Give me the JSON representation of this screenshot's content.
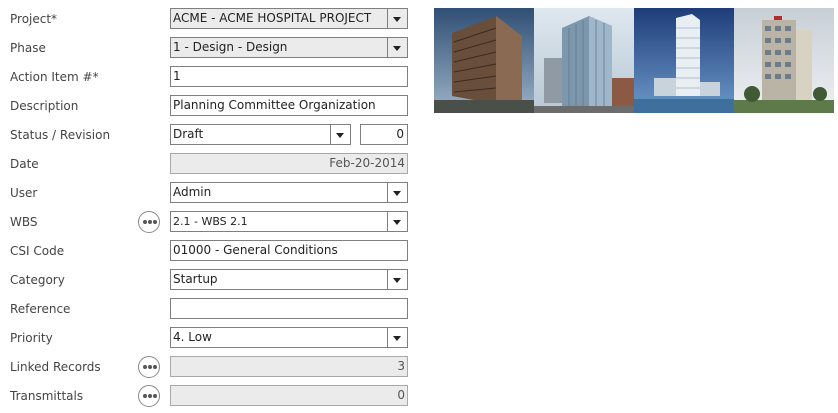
{
  "form": {
    "project": {
      "label": "Project*",
      "value": "ACME - ACME HOSPITAL PROJECT"
    },
    "phase": {
      "label": "Phase",
      "value": "1 - Design - Design"
    },
    "action_item": {
      "label": "Action Item #*",
      "value": "1"
    },
    "description": {
      "label": "Description",
      "value": "Planning Committee Organization"
    },
    "status": {
      "label": "Status / Revision",
      "value": "Draft",
      "revision": "0"
    },
    "date": {
      "label": "Date",
      "value": "Feb-20-2014"
    },
    "user": {
      "label": "User",
      "value": "Admin"
    },
    "wbs": {
      "label": "WBS",
      "value": "2.1 - WBS 2.1"
    },
    "csi": {
      "label": "CSI Code",
      "value": "01000 - General Conditions"
    },
    "category": {
      "label": "Category",
      "value": "Startup"
    },
    "reference": {
      "label": "Reference",
      "value": ""
    },
    "priority": {
      "label": "Priority",
      "value": "4. Low"
    },
    "linked": {
      "label": "Linked Records",
      "value": "3"
    },
    "transmittals": {
      "label": "Transmittals",
      "value": "0"
    }
  },
  "icons": {
    "dropdown": "chevron-down-icon",
    "picker": "ellipsis-icon"
  },
  "colors": {
    "readonly_bg": "#ebebeb",
    "border": "#7f7f7f"
  }
}
